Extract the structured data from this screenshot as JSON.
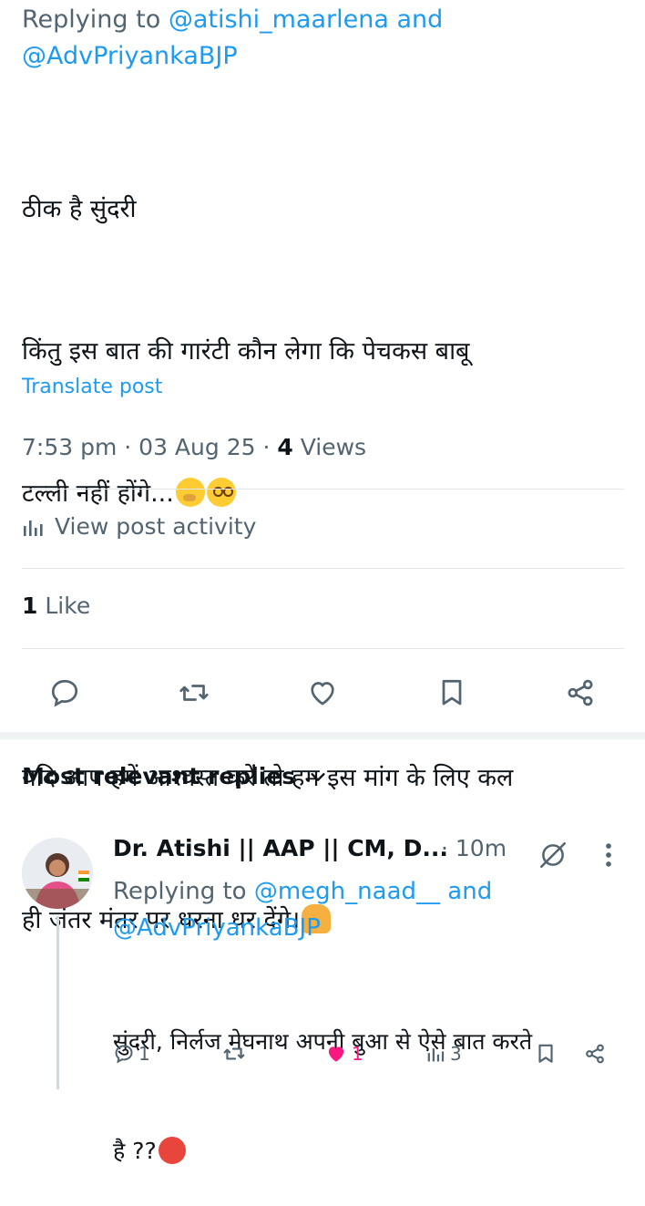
{
  "post": {
    "replying_prefix": "Replying to",
    "replying_user1": "@atishi_maarlena",
    "replying_and": "and",
    "replying_user2": "@AdvPriyankaBJP",
    "line1": "ठीक है सुंदरी",
    "line2": "किंतु इस बात की गारंटी कौन लेगा कि पेचकस बाबू",
    "line3": "टल्ली नहीं होंगे...",
    "line4": "यदि आप हमें आश्वस्त करें तो हम इस मांग के लिए कल",
    "line5": "ही जंतर मंतर पर धरना धर देंगे।",
    "translate_label": "Translate post",
    "time": "7:53 pm",
    "date": "03 Aug 25",
    "sep": "·",
    "views_count": "4",
    "views_label": "Views",
    "activity_label": "View post activity",
    "likes_count": "1",
    "likes_label": "Like"
  },
  "replies_section": {
    "sort_label": "Most relevant replies"
  },
  "reply": {
    "name": "Dr. Atishi || AAP || CM, D...",
    "sep": "·",
    "time": "10m",
    "replying_prefix": "Replying to",
    "replying_user1": "@megh_naad__",
    "replying_and": "and",
    "replying_user2": "@AdvPriyankaBJP",
    "line1": "सुंदरी, निर्लज मेघनाथ अपनी बुआ से ऐसे बात करते",
    "line2": "है ??",
    "reply_count": "1",
    "like_count": "1",
    "views_count": "3"
  },
  "colors": {
    "accent": "#1d9bf0",
    "secondary_text": "#536471",
    "like_pink": "#f91880",
    "divider": "#e1e6ea"
  },
  "icons": [
    "reply-icon",
    "retweet-icon",
    "like-icon",
    "bookmark-icon",
    "share-icon",
    "analytics-icon",
    "chevron-down-icon",
    "grok-icon",
    "more-icon"
  ]
}
